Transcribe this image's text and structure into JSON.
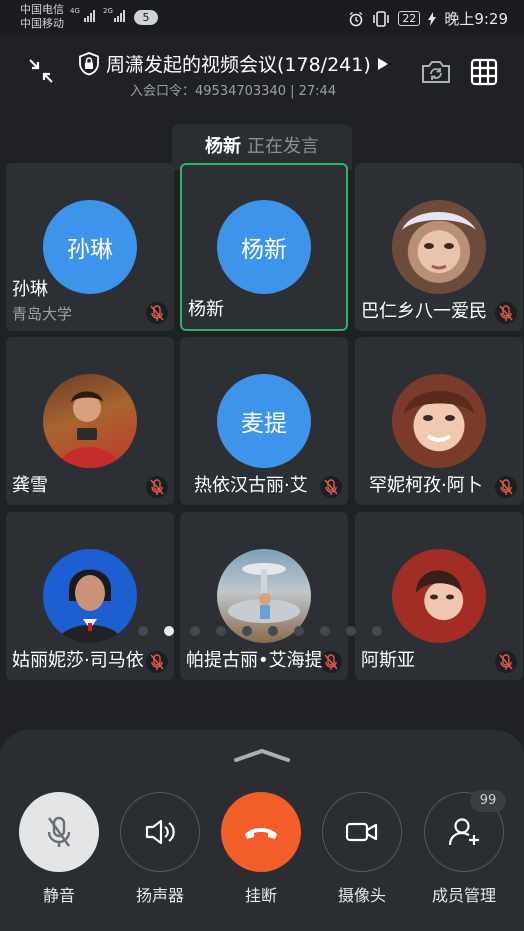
{
  "status_bar": {
    "carrier_1": "中国电信",
    "carrier_2": "中国移动",
    "net_1": "4G",
    "net_2": "2G",
    "notification_count": "5",
    "battery": "22",
    "time": "晚上9:29"
  },
  "header": {
    "title": "周潇发起的视频会议(178/241)",
    "meeting_info": "入会口令：49534703340 | 27:44"
  },
  "speaker": {
    "name": "杨新",
    "status": "正在发言"
  },
  "tiles": [
    {
      "name": "孙琳",
      "avatar_text": "孙琳",
      "org": "青岛大学"
    },
    {
      "name": "杨新",
      "avatar_text": "杨新",
      "active": true
    },
    {
      "name": "巴仁乡八一爱民",
      "photo": "portrait-young-woman"
    },
    {
      "name": "龚雪",
      "photo": "portrait-woman-camera"
    },
    {
      "name": "热依汉古丽·艾",
      "avatar_text": "麦提"
    },
    {
      "name": "罕妮柯孜·阿卜",
      "photo": "portrait-smiling-girl"
    },
    {
      "name": "姑丽妮莎·司马依",
      "photo": "portrait-formal-woman"
    },
    {
      "name": "帕提古丽•艾海提",
      "photo": "photo-child-fountain"
    },
    {
      "name": "阿斯亚",
      "photo": "portrait-woman-red"
    }
  ],
  "pagination": {
    "total": 10,
    "current": 2
  },
  "controls": {
    "mute": "静音",
    "speaker": "扬声器",
    "hangup": "挂断",
    "camera": "摄像头",
    "members": "成员管理",
    "member_badge": "99"
  },
  "colors": {
    "accent_blue": "#3d94ea",
    "active_border": "#2ab36a",
    "hangup_red": "#f35d2a"
  }
}
